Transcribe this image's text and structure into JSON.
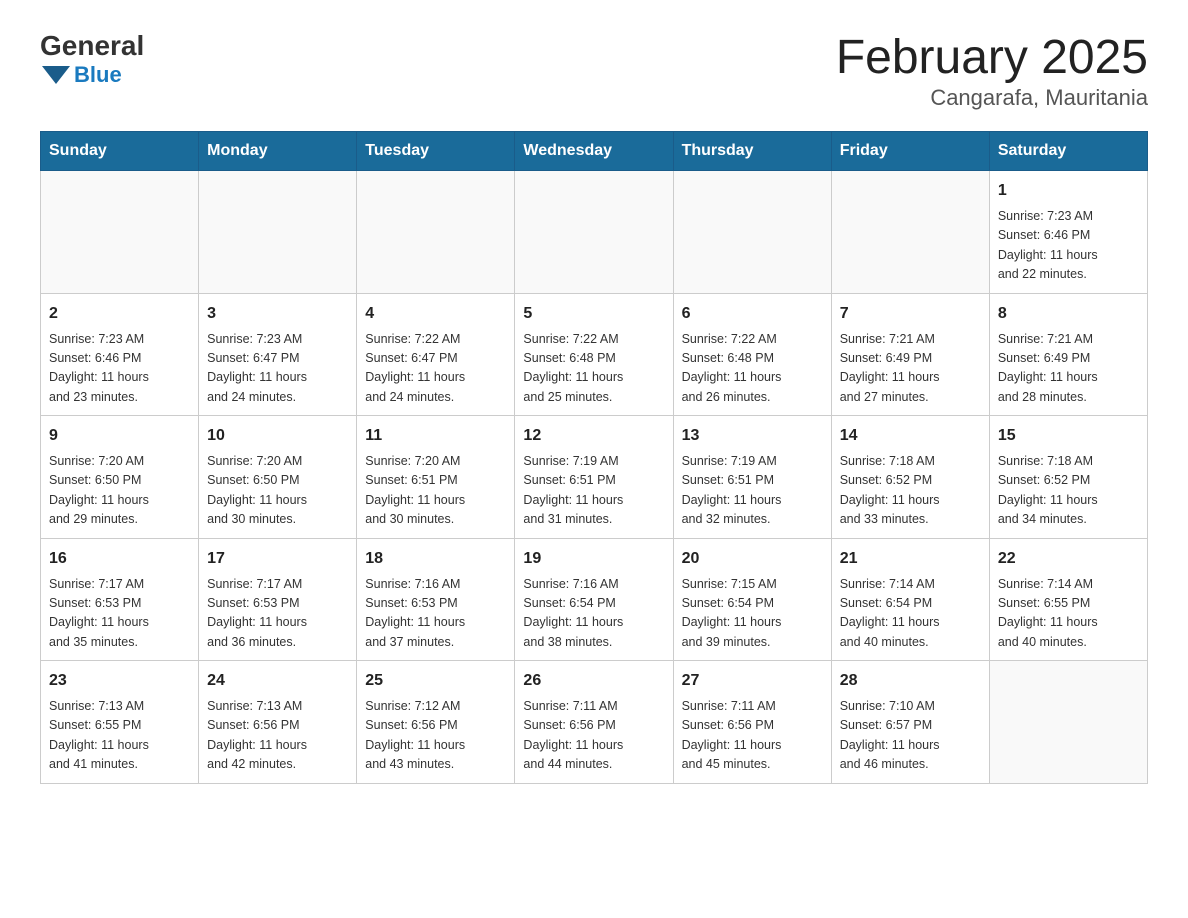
{
  "logo": {
    "general": "General",
    "blue": "Blue",
    "arrow_color": "#1a5c8a"
  },
  "title": "February 2025",
  "subtitle": "Cangarafa, Mauritania",
  "days_of_week": [
    "Sunday",
    "Monday",
    "Tuesday",
    "Wednesday",
    "Thursday",
    "Friday",
    "Saturday"
  ],
  "weeks": [
    {
      "days": [
        {
          "num": "",
          "info": ""
        },
        {
          "num": "",
          "info": ""
        },
        {
          "num": "",
          "info": ""
        },
        {
          "num": "",
          "info": ""
        },
        {
          "num": "",
          "info": ""
        },
        {
          "num": "",
          "info": ""
        },
        {
          "num": "1",
          "info": "Sunrise: 7:23 AM\nSunset: 6:46 PM\nDaylight: 11 hours\nand 22 minutes."
        }
      ]
    },
    {
      "days": [
        {
          "num": "2",
          "info": "Sunrise: 7:23 AM\nSunset: 6:46 PM\nDaylight: 11 hours\nand 23 minutes."
        },
        {
          "num": "3",
          "info": "Sunrise: 7:23 AM\nSunset: 6:47 PM\nDaylight: 11 hours\nand 24 minutes."
        },
        {
          "num": "4",
          "info": "Sunrise: 7:22 AM\nSunset: 6:47 PM\nDaylight: 11 hours\nand 24 minutes."
        },
        {
          "num": "5",
          "info": "Sunrise: 7:22 AM\nSunset: 6:48 PM\nDaylight: 11 hours\nand 25 minutes."
        },
        {
          "num": "6",
          "info": "Sunrise: 7:22 AM\nSunset: 6:48 PM\nDaylight: 11 hours\nand 26 minutes."
        },
        {
          "num": "7",
          "info": "Sunrise: 7:21 AM\nSunset: 6:49 PM\nDaylight: 11 hours\nand 27 minutes."
        },
        {
          "num": "8",
          "info": "Sunrise: 7:21 AM\nSunset: 6:49 PM\nDaylight: 11 hours\nand 28 minutes."
        }
      ]
    },
    {
      "days": [
        {
          "num": "9",
          "info": "Sunrise: 7:20 AM\nSunset: 6:50 PM\nDaylight: 11 hours\nand 29 minutes."
        },
        {
          "num": "10",
          "info": "Sunrise: 7:20 AM\nSunset: 6:50 PM\nDaylight: 11 hours\nand 30 minutes."
        },
        {
          "num": "11",
          "info": "Sunrise: 7:20 AM\nSunset: 6:51 PM\nDaylight: 11 hours\nand 30 minutes."
        },
        {
          "num": "12",
          "info": "Sunrise: 7:19 AM\nSunset: 6:51 PM\nDaylight: 11 hours\nand 31 minutes."
        },
        {
          "num": "13",
          "info": "Sunrise: 7:19 AM\nSunset: 6:51 PM\nDaylight: 11 hours\nand 32 minutes."
        },
        {
          "num": "14",
          "info": "Sunrise: 7:18 AM\nSunset: 6:52 PM\nDaylight: 11 hours\nand 33 minutes."
        },
        {
          "num": "15",
          "info": "Sunrise: 7:18 AM\nSunset: 6:52 PM\nDaylight: 11 hours\nand 34 minutes."
        }
      ]
    },
    {
      "days": [
        {
          "num": "16",
          "info": "Sunrise: 7:17 AM\nSunset: 6:53 PM\nDaylight: 11 hours\nand 35 minutes."
        },
        {
          "num": "17",
          "info": "Sunrise: 7:17 AM\nSunset: 6:53 PM\nDaylight: 11 hours\nand 36 minutes."
        },
        {
          "num": "18",
          "info": "Sunrise: 7:16 AM\nSunset: 6:53 PM\nDaylight: 11 hours\nand 37 minutes."
        },
        {
          "num": "19",
          "info": "Sunrise: 7:16 AM\nSunset: 6:54 PM\nDaylight: 11 hours\nand 38 minutes."
        },
        {
          "num": "20",
          "info": "Sunrise: 7:15 AM\nSunset: 6:54 PM\nDaylight: 11 hours\nand 39 minutes."
        },
        {
          "num": "21",
          "info": "Sunrise: 7:14 AM\nSunset: 6:54 PM\nDaylight: 11 hours\nand 40 minutes."
        },
        {
          "num": "22",
          "info": "Sunrise: 7:14 AM\nSunset: 6:55 PM\nDaylight: 11 hours\nand 40 minutes."
        }
      ]
    },
    {
      "days": [
        {
          "num": "23",
          "info": "Sunrise: 7:13 AM\nSunset: 6:55 PM\nDaylight: 11 hours\nand 41 minutes."
        },
        {
          "num": "24",
          "info": "Sunrise: 7:13 AM\nSunset: 6:56 PM\nDaylight: 11 hours\nand 42 minutes."
        },
        {
          "num": "25",
          "info": "Sunrise: 7:12 AM\nSunset: 6:56 PM\nDaylight: 11 hours\nand 43 minutes."
        },
        {
          "num": "26",
          "info": "Sunrise: 7:11 AM\nSunset: 6:56 PM\nDaylight: 11 hours\nand 44 minutes."
        },
        {
          "num": "27",
          "info": "Sunrise: 7:11 AM\nSunset: 6:56 PM\nDaylight: 11 hours\nand 45 minutes."
        },
        {
          "num": "28",
          "info": "Sunrise: 7:10 AM\nSunset: 6:57 PM\nDaylight: 11 hours\nand 46 minutes."
        },
        {
          "num": "",
          "info": ""
        }
      ]
    }
  ]
}
